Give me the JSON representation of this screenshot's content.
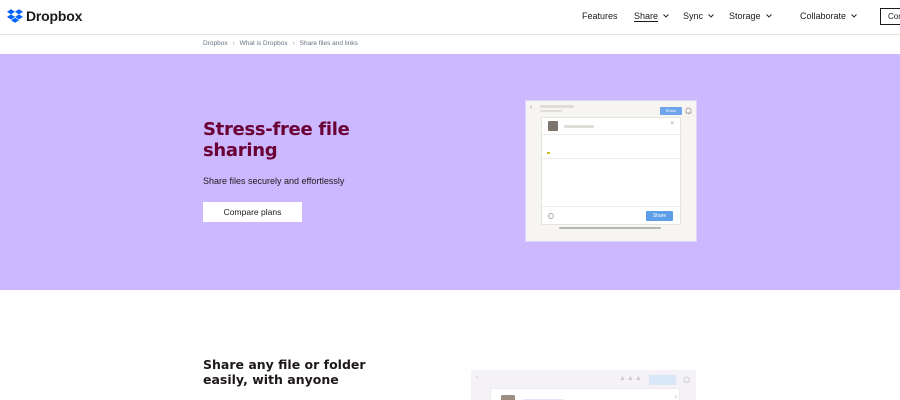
{
  "header": {
    "logo_text": "Dropbox",
    "brand_color": "#0061fe",
    "nav": [
      {
        "label": "Features",
        "has_chevron": false,
        "active": false
      },
      {
        "label": "Share",
        "has_chevron": true,
        "active": true
      },
      {
        "label": "Sync",
        "has_chevron": true,
        "active": false
      },
      {
        "label": "Storage",
        "has_chevron": true,
        "active": false
      },
      {
        "label": "Collaborate",
        "has_chevron": true,
        "active": false
      }
    ],
    "cta_label": "Con"
  },
  "breadcrumb": [
    "Dropbox",
    "What is Dropbox",
    "Share files and links"
  ],
  "hero": {
    "background_color": "#cbb8ff",
    "title": "Stress-free file sharing",
    "title_color": "#6b0034",
    "subtitle": "Share files securely and effortlessly",
    "button_label": "Compare plans"
  },
  "mock_dialog": {
    "top_share_label": "Share",
    "share_button_label": "Share",
    "accent_color": "#5c9fe8"
  },
  "section2": {
    "title": "Share any file or folder easily, with anyone"
  }
}
